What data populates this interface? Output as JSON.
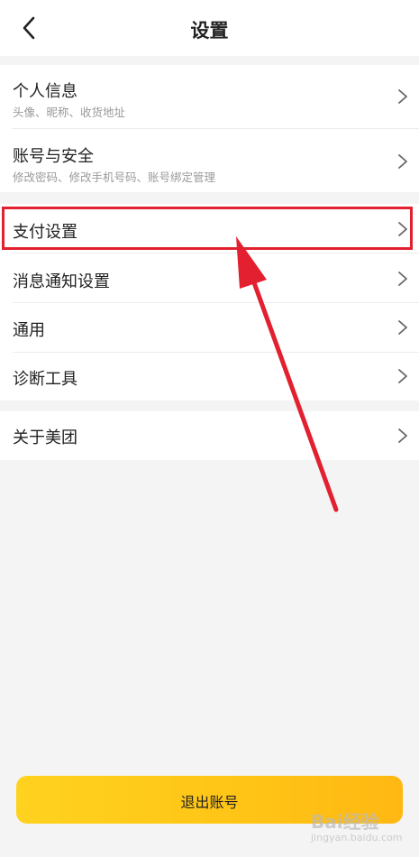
{
  "header": {
    "title": "设置"
  },
  "groups": [
    {
      "items": [
        {
          "label": "个人信息",
          "sub": "头像、昵称、收货地址"
        },
        {
          "label": "账号与安全",
          "sub": "修改密码、修改手机号码、账号绑定管理"
        }
      ]
    },
    {
      "items": [
        {
          "label": "支付设置"
        },
        {
          "label": "消息通知设置"
        },
        {
          "label": "通用"
        },
        {
          "label": "诊断工具"
        }
      ]
    },
    {
      "items": [
        {
          "label": "关于美团"
        }
      ]
    }
  ],
  "logout": {
    "label": "退出账号"
  },
  "watermark": {
    "brand": "Bai经验",
    "url": "jingyan.baidu.com"
  },
  "colors": {
    "accent": "#ffc416",
    "highlight": "#e2202f"
  },
  "icons": {
    "back": "chevron-left-icon",
    "row": "chevron-right-icon"
  }
}
